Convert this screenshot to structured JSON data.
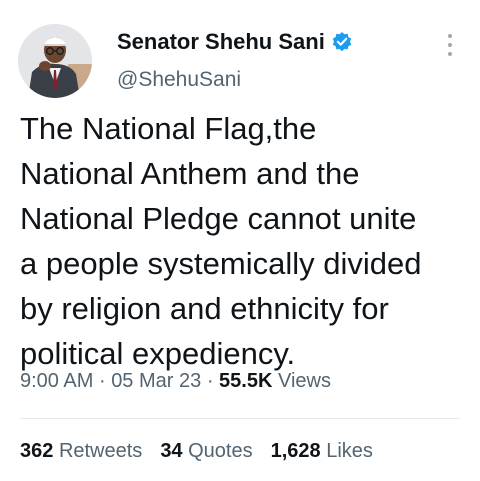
{
  "author": {
    "name": "Senator Shehu Sani",
    "handle": "@ShehuSani",
    "verified_color": "#1d9bf0"
  },
  "tweet": {
    "lines": [
      "The National Flag,the",
      "National Anthem and the",
      "National Pledge cannot unite",
      "a people systemically divided",
      "by religion and ethnicity for",
      "political expediency."
    ]
  },
  "meta": {
    "time": "9:00 AM",
    "sep1": "·",
    "date": "05 Mar 23",
    "sep2": "·",
    "views_count": "55.5K",
    "views_label": "Views"
  },
  "stats": {
    "retweets_count": "362",
    "retweets_label": "Retweets",
    "quotes_count": "34",
    "quotes_label": "Quotes",
    "likes_count": "1,628",
    "likes_label": "Likes"
  },
  "icons": {
    "verified": "verified-badge-icon",
    "more": "more-vertical-icon"
  }
}
